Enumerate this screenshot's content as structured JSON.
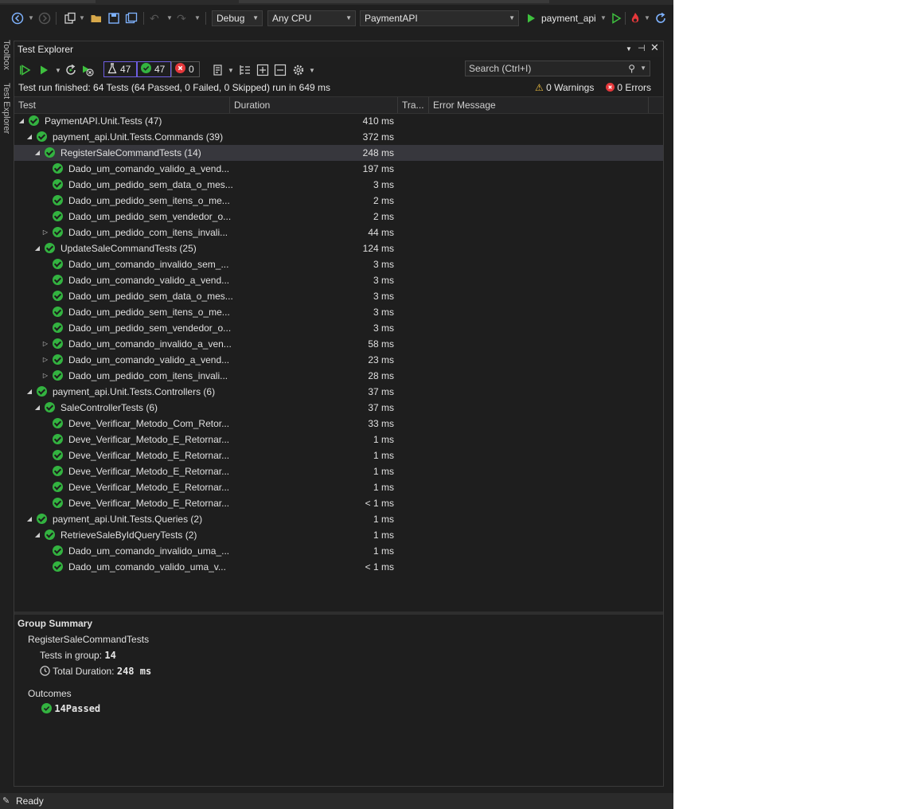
{
  "toolbar": {
    "config": "Debug",
    "platform": "Any CPU",
    "project": "PaymentAPI",
    "run_target": "payment_api"
  },
  "rail": {
    "toolbox": "Toolbox",
    "test_explorer": "Test Explorer"
  },
  "panel": {
    "title": "Test Explorer",
    "counts": {
      "total": "47",
      "passed": "47",
      "failed": "0"
    },
    "search_placeholder": "Search (Ctrl+I)",
    "status_message": "Test run finished: 64 Tests (64 Passed, 0 Failed, 0 Skipped) run in 649 ms",
    "warnings": "0 Warnings",
    "errors": "0 Errors"
  },
  "columns": [
    "Test",
    "Duration",
    "Tra...",
    "Error Message"
  ],
  "rows": [
    {
      "name": "PaymentAPI.Unit.Tests  (47)",
      "duration": "410 ms",
      "level": 0,
      "expand": "open"
    },
    {
      "name": "payment_api.Unit.Tests.Commands  (39)",
      "duration": "372 ms",
      "level": 1,
      "expand": "open"
    },
    {
      "name": "RegisterSaleCommandTests  (14)",
      "duration": "248 ms",
      "level": 2,
      "expand": "open",
      "selected": true
    },
    {
      "name": "Dado_um_comando_valido_a_vend...",
      "duration": "197 ms",
      "level": 3,
      "expand": ""
    },
    {
      "name": "Dado_um_pedido_sem_data_o_mes...",
      "duration": "3 ms",
      "level": 3,
      "expand": ""
    },
    {
      "name": "Dado_um_pedido_sem_itens_o_me...",
      "duration": "2 ms",
      "level": 3,
      "expand": ""
    },
    {
      "name": "Dado_um_pedido_sem_vendedor_o...",
      "duration": "2 ms",
      "level": 3,
      "expand": ""
    },
    {
      "name": "Dado_um_pedido_com_itens_invali...",
      "duration": "44 ms",
      "level": 3,
      "expand": "closed"
    },
    {
      "name": "UpdateSaleCommandTests  (25)",
      "duration": "124 ms",
      "level": 2,
      "expand": "open"
    },
    {
      "name": "Dado_um_comando_invalido_sem_...",
      "duration": "3 ms",
      "level": 3,
      "expand": ""
    },
    {
      "name": "Dado_um_comando_valido_a_vend...",
      "duration": "3 ms",
      "level": 3,
      "expand": ""
    },
    {
      "name": "Dado_um_pedido_sem_data_o_mes...",
      "duration": "3 ms",
      "level": 3,
      "expand": ""
    },
    {
      "name": "Dado_um_pedido_sem_itens_o_me...",
      "duration": "3 ms",
      "level": 3,
      "expand": ""
    },
    {
      "name": "Dado_um_pedido_sem_vendedor_o...",
      "duration": "3 ms",
      "level": 3,
      "expand": ""
    },
    {
      "name": "Dado_um_comando_invalido_a_ven...",
      "duration": "58 ms",
      "level": 3,
      "expand": "closed"
    },
    {
      "name": "Dado_um_comando_valido_a_vend...",
      "duration": "23 ms",
      "level": 3,
      "expand": "closed"
    },
    {
      "name": "Dado_um_pedido_com_itens_invali...",
      "duration": "28 ms",
      "level": 3,
      "expand": "closed"
    },
    {
      "name": "payment_api.Unit.Tests.Controllers  (6)",
      "duration": "37 ms",
      "level": 1,
      "expand": "open"
    },
    {
      "name": "SaleControllerTests  (6)",
      "duration": "37 ms",
      "level": 2,
      "expand": "open"
    },
    {
      "name": "Deve_Verificar_Metodo_Com_Retor...",
      "duration": "33 ms",
      "level": 3,
      "expand": ""
    },
    {
      "name": "Deve_Verificar_Metodo_E_Retornar...",
      "duration": "1 ms",
      "level": 3,
      "expand": ""
    },
    {
      "name": "Deve_Verificar_Metodo_E_Retornar...",
      "duration": "1 ms",
      "level": 3,
      "expand": ""
    },
    {
      "name": "Deve_Verificar_Metodo_E_Retornar...",
      "duration": "1 ms",
      "level": 3,
      "expand": ""
    },
    {
      "name": "Deve_Verificar_Metodo_E_Retornar...",
      "duration": "1 ms",
      "level": 3,
      "expand": ""
    },
    {
      "name": "Deve_Verificar_Metodo_E_Retornar...",
      "duration": "< 1 ms",
      "level": 3,
      "expand": ""
    },
    {
      "name": "payment_api.Unit.Tests.Queries  (2)",
      "duration": "1 ms",
      "level": 1,
      "expand": "open"
    },
    {
      "name": "RetrieveSaleByIdQueryTests  (2)",
      "duration": "1 ms",
      "level": 2,
      "expand": "open"
    },
    {
      "name": "Dado_um_comando_invalido_uma_...",
      "duration": "1 ms",
      "level": 3,
      "expand": ""
    },
    {
      "name": "Dado_um_comando_valido_uma_v...",
      "duration": "< 1 ms",
      "level": 3,
      "expand": ""
    }
  ],
  "summary": {
    "heading": "Group Summary",
    "group_name": "RegisterSaleCommandTests",
    "tests_in_group_label": "Tests in group:",
    "tests_in_group_value": "14",
    "total_duration_label": "Total Duration:",
    "total_duration_value": "248 ms",
    "outcomes_label": "Outcomes",
    "passed_count": "14",
    "passed_label": "Passed"
  },
  "statusbar": {
    "text": "Ready"
  },
  "colors": {
    "passed": "#33b340",
    "failed": "#e5383b",
    "accent": "#7fb3ff",
    "selection": "#37373d"
  }
}
